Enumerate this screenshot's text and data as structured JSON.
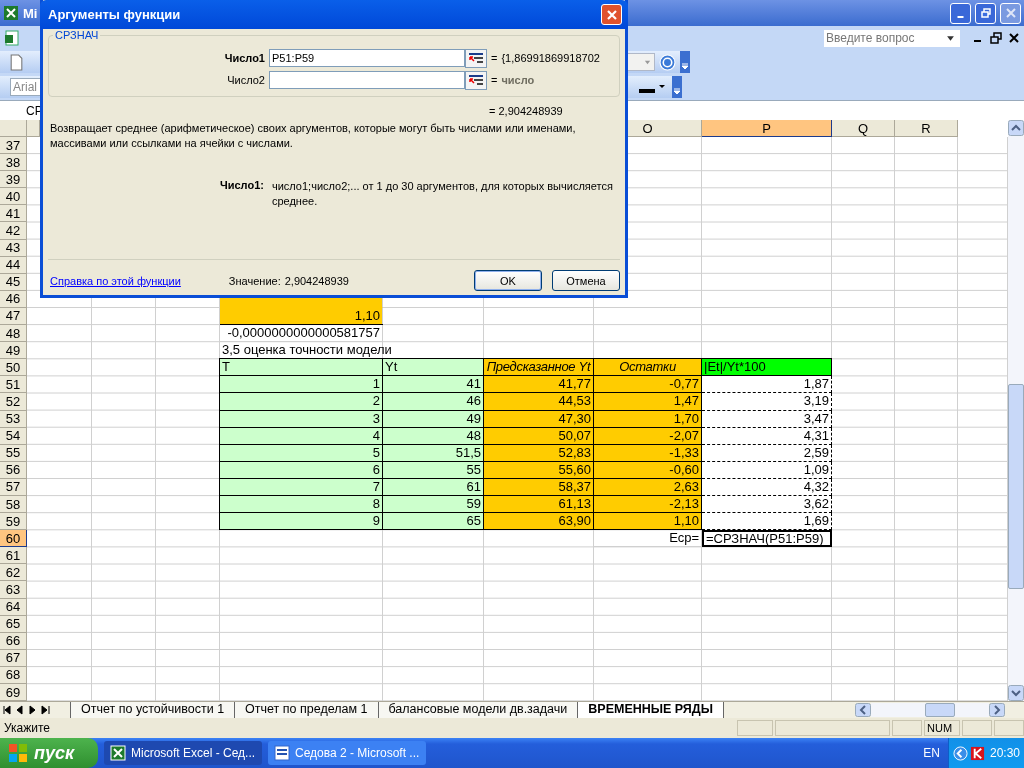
{
  "excel_window": {
    "title": "Mi",
    "help_search": {
      "placeholder": "Введите вопрос"
    }
  },
  "formatting_toolbar": {
    "font_name": "Arial"
  },
  "formula_bar": {
    "name_box": "СР"
  },
  "column_headers": [
    {
      "label": "O",
      "selected": false
    },
    {
      "label": "P",
      "selected": true
    },
    {
      "label": "Q",
      "selected": false
    },
    {
      "label": "R",
      "selected": false
    }
  ],
  "row_headers": [
    {
      "label": "37",
      "selected": false
    },
    {
      "label": "38",
      "selected": false
    },
    {
      "label": "39",
      "selected": false
    },
    {
      "label": "40",
      "selected": false
    },
    {
      "label": "41",
      "selected": false
    },
    {
      "label": "42",
      "selected": false
    },
    {
      "label": "43",
      "selected": false
    },
    {
      "label": "44",
      "selected": false
    },
    {
      "label": "45",
      "selected": false
    },
    {
      "label": "46",
      "selected": false
    },
    {
      "label": "47",
      "selected": false
    },
    {
      "label": "48",
      "selected": false
    },
    {
      "label": "49",
      "selected": false
    },
    {
      "label": "50",
      "selected": false
    },
    {
      "label": "51",
      "selected": false
    },
    {
      "label": "52",
      "selected": false
    },
    {
      "label": "53",
      "selected": false
    },
    {
      "label": "54",
      "selected": false
    },
    {
      "label": "55",
      "selected": false
    },
    {
      "label": "56",
      "selected": false
    },
    {
      "label": "57",
      "selected": false
    },
    {
      "label": "58",
      "selected": false
    },
    {
      "label": "59",
      "selected": false
    },
    {
      "label": "60",
      "selected": true
    },
    {
      "label": "61",
      "selected": false
    },
    {
      "label": "62",
      "selected": false
    },
    {
      "label": "63",
      "selected": false
    },
    {
      "label": "64",
      "selected": false
    },
    {
      "label": "65",
      "selected": false
    },
    {
      "label": "66",
      "selected": false
    },
    {
      "label": "67",
      "selected": false
    },
    {
      "label": "68",
      "selected": false
    },
    {
      "label": "69",
      "selected": false
    }
  ],
  "sheet": {
    "residual_cells": [
      "1,10"
    ],
    "residual_sum": "-0,0000000000000581757",
    "caption": "3,5 оценка точности модели",
    "table": {
      "columns": [
        {
          "label": "T",
          "kind": "input"
        },
        {
          "label": "Yt",
          "kind": "input"
        },
        {
          "label": "Предсказанное Yt",
          "kind": "computed"
        },
        {
          "label": "Остатки",
          "kind": "computed"
        },
        {
          "label": "|Et|/Yt*100",
          "kind": "result"
        }
      ],
      "rows": [
        [
          "1",
          "41",
          "41,77",
          "-0,77",
          "1,87"
        ],
        [
          "2",
          "46",
          "44,53",
          "1,47",
          "3,19"
        ],
        [
          "3",
          "49",
          "47,30",
          "1,70",
          "3,47"
        ],
        [
          "4",
          "48",
          "50,07",
          "-2,07",
          "4,31"
        ],
        [
          "5",
          "51,5",
          "52,83",
          "-1,33",
          "2,59"
        ],
        [
          "6",
          "55",
          "55,60",
          "-0,60",
          "1,09"
        ],
        [
          "7",
          "61",
          "58,37",
          "2,63",
          "4,32"
        ],
        [
          "8",
          "59",
          "61,13",
          "-2,13",
          "3,62"
        ],
        [
          "9",
          "65",
          "63,90",
          "1,10",
          "1,69"
        ]
      ]
    },
    "mean_label": "Еср=",
    "mean_formula": "=СРЗНАЧ(P51:P59)"
  },
  "sheet_tabs": [
    {
      "label": "Отчет по устойчивости 1",
      "selected": false
    },
    {
      "label": "Отчет по пределам 1",
      "selected": false
    },
    {
      "label": "балансовые модели дв.задачи",
      "selected": false
    },
    {
      "label": "ВРЕМЕННЫЕ РЯДЫ",
      "selected": true
    }
  ],
  "status_bar": {
    "message": "Укажите",
    "indicator": "NUM"
  },
  "taskbar": {
    "start": "пуск",
    "tasks": [
      {
        "label": "Microsoft Excel - Сед...",
        "kind": "spreadsheet",
        "selected": true
      },
      {
        "label": "Седова 2 - Microsoft ...",
        "kind": "document",
        "selected": false
      }
    ],
    "language": "EN",
    "clock": "20:30"
  },
  "dialog": {
    "title": "Аргументы функции",
    "function_name": "СРЗНАЧ",
    "arguments": [
      {
        "label": "Число1",
        "value": "P51:P59",
        "equals": "=",
        "result": "{1,86991869918702",
        "selected": true,
        "hint": false
      },
      {
        "label": "Число2",
        "equals": "=",
        "result": "число",
        "selected": false,
        "hint": true
      }
    ],
    "formula_result": "= 2,904248939",
    "description": "Возвращает среднее (арифметическое) своих аргументов, которые могут быть числами или именами, массивами или ссылками на ячейки с числами.",
    "argument_help": {
      "label": "Число1:",
      "text": "число1;число2;... от 1 до 30 аргументов, для которых вычисляется среднее."
    },
    "help_link": "Справка по этой функции",
    "value_label": "Значение:",
    "value": "2,904248939",
    "buttons": [
      "OK",
      "Отмена"
    ]
  }
}
